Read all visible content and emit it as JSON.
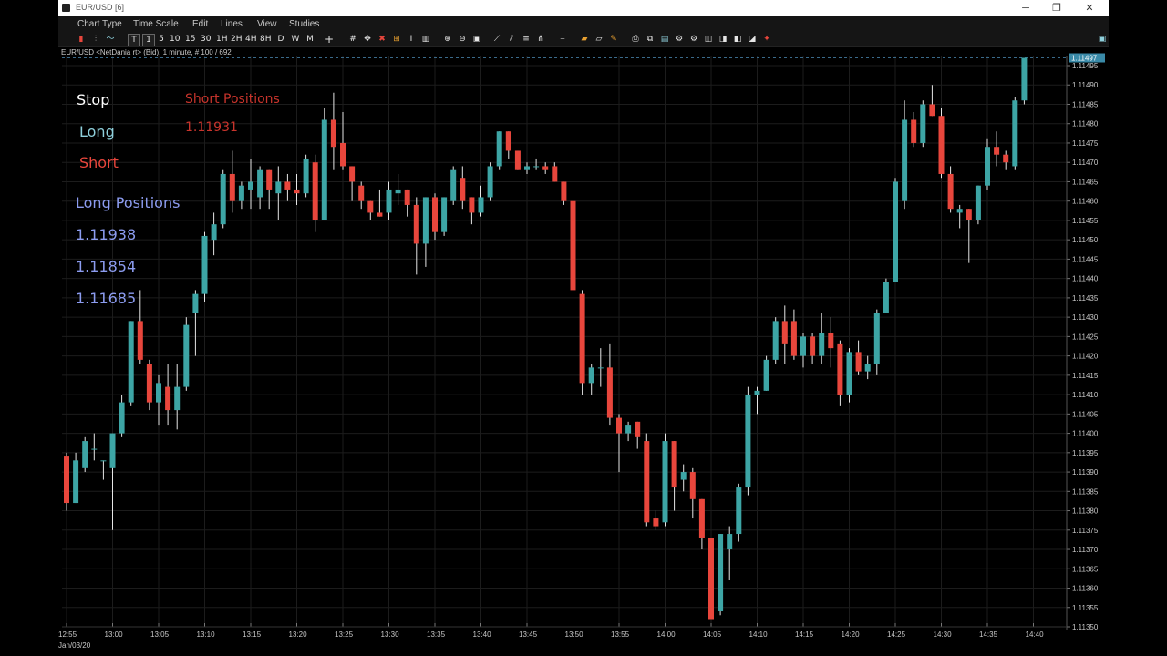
{
  "window": {
    "title": "EUR/USD [6]",
    "controls": [
      "─",
      "❐",
      "✕"
    ]
  },
  "menu": [
    "Chart Type",
    "Time Scale",
    "Edit",
    "Lines",
    "View",
    "Studies"
  ],
  "toolbar": {
    "timeframes": [
      "T",
      "1",
      "5",
      "10",
      "15",
      "30",
      "1H",
      "2H",
      "4H",
      "8H",
      "D",
      "W",
      "M"
    ]
  },
  "chart_header": "EUR/USD <NetDania rt> (Bid), 1 minute, # 100 / 692",
  "overlay": {
    "stop": "Stop",
    "long": "Long",
    "short": "Short",
    "long_positions_title": "Long Positions",
    "long_positions": [
      "1.11938",
      "1.11854",
      "1.11685"
    ],
    "short_positions_title": "Short Positions",
    "short_positions": [
      "1.11931"
    ]
  },
  "colors": {
    "bull": "#3da5a5",
    "bear": "#e8463c",
    "stop_text": "#ffffff",
    "long_text": "#8fd0dc",
    "short_text": "#e8463c",
    "long_positions_text": "#8c9cf0",
    "short_positions_text": "#c8342c",
    "grid": "#1c1c1c",
    "axis_text": "#c8c8c8",
    "current_price_badge": "#3a8aa8"
  },
  "chart_data": {
    "type": "candlestick",
    "symbol": "EUR/USD",
    "interval": "1 minute",
    "current_price": 1.11497,
    "y_ticks": [
      "1.11495",
      "1.11490",
      "1.11485",
      "1.11480",
      "1.11475",
      "1.11470",
      "1.11465",
      "1.11460",
      "1.11455",
      "1.11450",
      "1.11445",
      "1.11440",
      "1.11435",
      "1.11430",
      "1.11425",
      "1.11420",
      "1.11415",
      "1.11410",
      "1.11405",
      "1.11400",
      "1.11395",
      "1.11390",
      "1.11385",
      "1.11380",
      "1.11375",
      "1.11370",
      "1.11365",
      "1.11360",
      "1.11355",
      "1.11350"
    ],
    "ylim": [
      1.1135,
      1.11497
    ],
    "x_ticks": [
      "12:55",
      "13:00",
      "13:05",
      "13:10",
      "13:15",
      "13:20",
      "13:25",
      "13:30",
      "13:35",
      "13:40",
      "13:45",
      "13:50",
      "13:55",
      "14:00",
      "14:05",
      "14:10",
      "14:15",
      "14:20",
      "14:25",
      "14:30",
      "14:35",
      "14:40"
    ],
    "date_label": "Jan/03/20",
    "candles": [
      {
        "o": 1.11394,
        "h": 1.11395,
        "l": 1.1138,
        "c": 1.11382
      },
      {
        "o": 1.11382,
        "h": 1.11395,
        "l": 1.11382,
        "c": 1.11393
      },
      {
        "o": 1.11391,
        "h": 1.11399,
        "l": 1.1139,
        "c": 1.11398
      },
      {
        "o": 1.11396,
        "h": 1.114,
        "l": 1.11393,
        "c": 1.11396
      },
      {
        "o": 1.11393,
        "h": 1.11393,
        "l": 1.11388,
        "c": 1.11393
      },
      {
        "o": 1.11391,
        "h": 1.114,
        "l": 1.11375,
        "c": 1.114
      },
      {
        "o": 1.114,
        "h": 1.1141,
        "l": 1.11399,
        "c": 1.11408
      },
      {
        "o": 1.11408,
        "h": 1.11429,
        "l": 1.11407,
        "c": 1.11429
      },
      {
        "o": 1.11429,
        "h": 1.11437,
        "l": 1.11418,
        "c": 1.11419
      },
      {
        "o": 1.11418,
        "h": 1.11419,
        "l": 1.11406,
        "c": 1.11408
      },
      {
        "o": 1.11408,
        "h": 1.11415,
        "l": 1.11402,
        "c": 1.11413
      },
      {
        "o": 1.11412,
        "h": 1.11418,
        "l": 1.11402,
        "c": 1.11406
      },
      {
        "o": 1.11406,
        "h": 1.11418,
        "l": 1.11401,
        "c": 1.11412
      },
      {
        "o": 1.11412,
        "h": 1.1143,
        "l": 1.11411,
        "c": 1.11428
      },
      {
        "o": 1.11431,
        "h": 1.11437,
        "l": 1.1142,
        "c": 1.11436
      },
      {
        "o": 1.11436,
        "h": 1.11452,
        "l": 1.11434,
        "c": 1.11451
      },
      {
        "o": 1.1145,
        "h": 1.11457,
        "l": 1.11446,
        "c": 1.11454
      },
      {
        "o": 1.11454,
        "h": 1.11468,
        "l": 1.11453,
        "c": 1.11467
      },
      {
        "o": 1.11467,
        "h": 1.11473,
        "l": 1.11457,
        "c": 1.1146
      },
      {
        "o": 1.1146,
        "h": 1.11465,
        "l": 1.11458,
        "c": 1.11464
      },
      {
        "o": 1.11463,
        "h": 1.11471,
        "l": 1.11458,
        "c": 1.11465
      },
      {
        "o": 1.11461,
        "h": 1.11469,
        "l": 1.11458,
        "c": 1.11468
      },
      {
        "o": 1.11468,
        "h": 1.11468,
        "l": 1.11458,
        "c": 1.11463
      },
      {
        "o": 1.11462,
        "h": 1.11469,
        "l": 1.11455,
        "c": 1.11465
      },
      {
        "o": 1.11465,
        "h": 1.11467,
        "l": 1.1146,
        "c": 1.11463
      },
      {
        "o": 1.11463,
        "h": 1.11467,
        "l": 1.11459,
        "c": 1.11462
      },
      {
        "o": 1.11462,
        "h": 1.11472,
        "l": 1.11461,
        "c": 1.11471
      },
      {
        "o": 1.1147,
        "h": 1.11472,
        "l": 1.11452,
        "c": 1.11455
      },
      {
        "o": 1.11455,
        "h": 1.11484,
        "l": 1.11455,
        "c": 1.11481
      },
      {
        "o": 1.11481,
        "h": 1.11488,
        "l": 1.11468,
        "c": 1.11474
      },
      {
        "o": 1.11475,
        "h": 1.11483,
        "l": 1.11468,
        "c": 1.11469
      },
      {
        "o": 1.11469,
        "h": 1.11469,
        "l": 1.1146,
        "c": 1.11465
      },
      {
        "o": 1.11464,
        "h": 1.11465,
        "l": 1.11458,
        "c": 1.1146
      },
      {
        "o": 1.1146,
        "h": 1.1146,
        "l": 1.11455,
        "c": 1.11457
      },
      {
        "o": 1.11457,
        "h": 1.11463,
        "l": 1.11456,
        "c": 1.11456
      },
      {
        "o": 1.11457,
        "h": 1.11465,
        "l": 1.11455,
        "c": 1.11463
      },
      {
        "o": 1.11462,
        "h": 1.11467,
        "l": 1.11459,
        "c": 1.11463
      },
      {
        "o": 1.11463,
        "h": 1.11463,
        "l": 1.11456,
        "c": 1.11459
      },
      {
        "o": 1.11459,
        "h": 1.11461,
        "l": 1.11441,
        "c": 1.11449
      },
      {
        "o": 1.11449,
        "h": 1.11461,
        "l": 1.11443,
        "c": 1.11461
      },
      {
        "o": 1.11461,
        "h": 1.11462,
        "l": 1.1145,
        "c": 1.11452
      },
      {
        "o": 1.11452,
        "h": 1.11461,
        "l": 1.11451,
        "c": 1.11461
      },
      {
        "o": 1.1146,
        "h": 1.11469,
        "l": 1.11459,
        "c": 1.11468
      },
      {
        "o": 1.11466,
        "h": 1.11469,
        "l": 1.11458,
        "c": 1.1146
      },
      {
        "o": 1.11461,
        "h": 1.11461,
        "l": 1.11454,
        "c": 1.11457
      },
      {
        "o": 1.11457,
        "h": 1.11464,
        "l": 1.11456,
        "c": 1.11461
      },
      {
        "o": 1.11461,
        "h": 1.1147,
        "l": 1.1146,
        "c": 1.11469
      },
      {
        "o": 1.11469,
        "h": 1.11478,
        "l": 1.11468,
        "c": 1.11478
      },
      {
        "o": 1.11478,
        "h": 1.11478,
        "l": 1.11471,
        "c": 1.11473
      },
      {
        "o": 1.11473,
        "h": 1.11473,
        "l": 1.11468,
        "c": 1.11468
      },
      {
        "o": 1.11468,
        "h": 1.1147,
        "l": 1.11467,
        "c": 1.11469
      },
      {
        "o": 1.11469,
        "h": 1.11471,
        "l": 1.11468,
        "c": 1.11469
      },
      {
        "o": 1.11469,
        "h": 1.1147,
        "l": 1.11467,
        "c": 1.11468
      },
      {
        "o": 1.11469,
        "h": 1.1147,
        "l": 1.11465,
        "c": 1.11465
      },
      {
        "o": 1.11465,
        "h": 1.11465,
        "l": 1.11459,
        "c": 1.1146
      },
      {
        "o": 1.1146,
        "h": 1.1146,
        "l": 1.11436,
        "c": 1.11437
      },
      {
        "o": 1.11436,
        "h": 1.11437,
        "l": 1.1141,
        "c": 1.11413
      },
      {
        "o": 1.11413,
        "h": 1.11418,
        "l": 1.1141,
        "c": 1.11417
      },
      {
        "o": 1.11417,
        "h": 1.11422,
        "l": 1.11412,
        "c": 1.11417
      },
      {
        "o": 1.11417,
        "h": 1.11423,
        "l": 1.11402,
        "c": 1.11404
      },
      {
        "o": 1.11404,
        "h": 1.11405,
        "l": 1.1139,
        "c": 1.114
      },
      {
        "o": 1.114,
        "h": 1.11403,
        "l": 1.11398,
        "c": 1.11402
      },
      {
        "o": 1.11403,
        "h": 1.11403,
        "l": 1.11396,
        "c": 1.11399
      },
      {
        "o": 1.11398,
        "h": 1.114,
        "l": 1.11376,
        "c": 1.11377
      },
      {
        "o": 1.11378,
        "h": 1.1138,
        "l": 1.11375,
        "c": 1.11376
      },
      {
        "o": 1.11377,
        "h": 1.114,
        "l": 1.11376,
        "c": 1.11398
      },
      {
        "o": 1.11398,
        "h": 1.11398,
        "l": 1.1138,
        "c": 1.11386
      },
      {
        "o": 1.11388,
        "h": 1.11392,
        "l": 1.11385,
        "c": 1.1139
      },
      {
        "o": 1.1139,
        "h": 1.11391,
        "l": 1.11378,
        "c": 1.11383
      },
      {
        "o": 1.11383,
        "h": 1.11383,
        "l": 1.1137,
        "c": 1.11373
      },
      {
        "o": 1.11373,
        "h": 1.11373,
        "l": 1.11352,
        "c": 1.11352
      },
      {
        "o": 1.11354,
        "h": 1.11374,
        "l": 1.11353,
        "c": 1.11374
      },
      {
        "o": 1.1137,
        "h": 1.11376,
        "l": 1.11362,
        "c": 1.11374
      },
      {
        "o": 1.11374,
        "h": 1.11387,
        "l": 1.11372,
        "c": 1.11386
      },
      {
        "o": 1.11386,
        "h": 1.11412,
        "l": 1.11384,
        "c": 1.1141
      },
      {
        "o": 1.1141,
        "h": 1.11412,
        "l": 1.11405,
        "c": 1.11411
      },
      {
        "o": 1.11411,
        "h": 1.1142,
        "l": 1.11411,
        "c": 1.11419
      },
      {
        "o": 1.11419,
        "h": 1.1143,
        "l": 1.11418,
        "c": 1.11429
      },
      {
        "o": 1.11429,
        "h": 1.11433,
        "l": 1.11418,
        "c": 1.11423
      },
      {
        "o": 1.11429,
        "h": 1.11432,
        "l": 1.11419,
        "c": 1.1142
      },
      {
        "o": 1.1142,
        "h": 1.11426,
        "l": 1.11417,
        "c": 1.11425
      },
      {
        "o": 1.11425,
        "h": 1.11426,
        "l": 1.11418,
        "c": 1.1142
      },
      {
        "o": 1.1142,
        "h": 1.11431,
        "l": 1.11418,
        "c": 1.11426
      },
      {
        "o": 1.11426,
        "h": 1.1143,
        "l": 1.11417,
        "c": 1.11422
      },
      {
        "o": 1.11423,
        "h": 1.11424,
        "l": 1.11407,
        "c": 1.1141
      },
      {
        "o": 1.1141,
        "h": 1.11422,
        "l": 1.11408,
        "c": 1.11421
      },
      {
        "o": 1.11421,
        "h": 1.11424,
        "l": 1.11415,
        "c": 1.11416
      },
      {
        "o": 1.11416,
        "h": 1.1142,
        "l": 1.11414,
        "c": 1.11418
      },
      {
        "o": 1.11418,
        "h": 1.11432,
        "l": 1.11415,
        "c": 1.11431
      },
      {
        "o": 1.11431,
        "h": 1.1144,
        "l": 1.11431,
        "c": 1.11439
      },
      {
        "o": 1.11439,
        "h": 1.11466,
        "l": 1.11439,
        "c": 1.11465
      },
      {
        "o": 1.1146,
        "h": 1.11486,
        "l": 1.11458,
        "c": 1.11481
      },
      {
        "o": 1.11481,
        "h": 1.11483,
        "l": 1.11474,
        "c": 1.11475
      },
      {
        "o": 1.11475,
        "h": 1.11486,
        "l": 1.11474,
        "c": 1.11485
      },
      {
        "o": 1.11485,
        "h": 1.1149,
        "l": 1.11482,
        "c": 1.11482
      },
      {
        "o": 1.11482,
        "h": 1.11484,
        "l": 1.11466,
        "c": 1.11467
      },
      {
        "o": 1.11467,
        "h": 1.11469,
        "l": 1.11457,
        "c": 1.11458
      },
      {
        "o": 1.11457,
        "h": 1.11459,
        "l": 1.11453,
        "c": 1.11458
      },
      {
        "o": 1.11458,
        "h": 1.11458,
        "l": 1.11444,
        "c": 1.11455
      },
      {
        "o": 1.11455,
        "h": 1.11464,
        "l": 1.11454,
        "c": 1.11464
      },
      {
        "o": 1.11464,
        "h": 1.11476,
        "l": 1.11463,
        "c": 1.11474
      },
      {
        "o": 1.11474,
        "h": 1.11478,
        "l": 1.11469,
        "c": 1.11472
      },
      {
        "o": 1.11472,
        "h": 1.11473,
        "l": 1.11468,
        "c": 1.1147
      },
      {
        "o": 1.11469,
        "h": 1.11487,
        "l": 1.11468,
        "c": 1.11486
      },
      {
        "o": 1.11486,
        "h": 1.11497,
        "l": 1.11485,
        "c": 1.11497
      }
    ]
  }
}
